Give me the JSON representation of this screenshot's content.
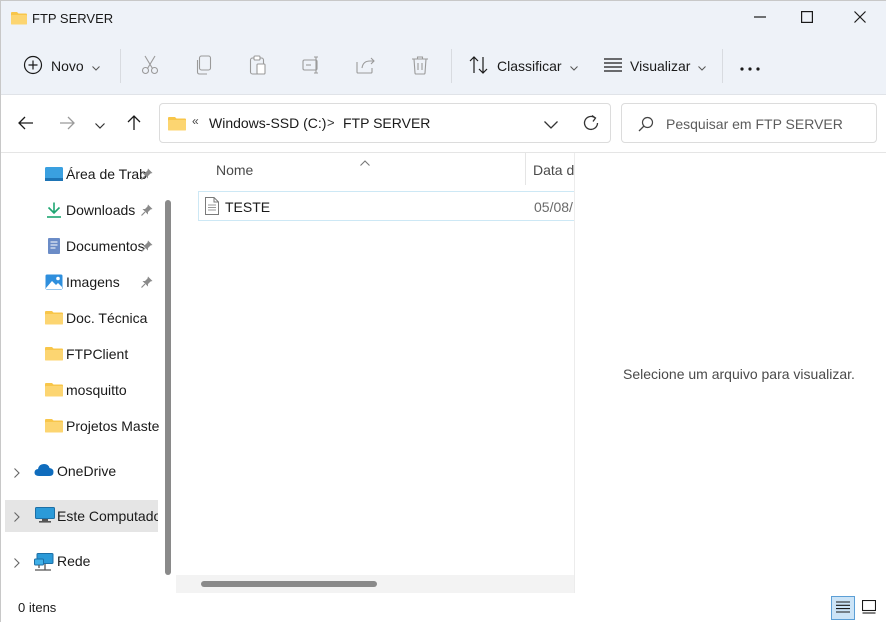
{
  "window": {
    "title": "FTP SERVER"
  },
  "toolbar": {
    "new_label": "Novo",
    "sort_label": "Classificar",
    "view_label": "Visualizar",
    "more_label": "•••"
  },
  "address": {
    "overflow": "«",
    "segments": [
      "Windows-SSD (C:)",
      "FTP SERVER"
    ],
    "separator": ">"
  },
  "search": {
    "placeholder": "Pesquisar em FTP SERVER"
  },
  "sidebar": {
    "quick_access": [
      {
        "label": "Área de Trab",
        "icon": "desktop-icon",
        "pinned": true
      },
      {
        "label": "Downloads",
        "icon": "download-icon",
        "pinned": true
      },
      {
        "label": "Documentos",
        "icon": "document-icon",
        "pinned": true
      },
      {
        "label": "Imagens",
        "icon": "image-icon",
        "pinned": true
      },
      {
        "label": "Doc. Técnica",
        "icon": "folder-icon",
        "pinned": false
      },
      {
        "label": "FTPClient",
        "icon": "folder-icon",
        "pinned": false
      },
      {
        "label": "mosquitto",
        "icon": "folder-icon",
        "pinned": false
      },
      {
        "label": "Projetos Master",
        "icon": "folder-icon",
        "pinned": false
      }
    ],
    "roots": [
      {
        "label": "OneDrive",
        "icon": "cloud-icon"
      },
      {
        "label": "Este Computador",
        "icon": "computer-icon",
        "selected": true
      },
      {
        "label": "Rede",
        "icon": "network-icon"
      }
    ]
  },
  "filelist": {
    "columns": [
      "Nome",
      "Data d"
    ],
    "files": [
      {
        "name": "TESTE",
        "date": "05/08/"
      }
    ]
  },
  "preview": {
    "message": "Selecione um arquivo para visualizar."
  },
  "status": {
    "item_count": "0 itens"
  },
  "colors": {
    "chrome_bg": "#eef2f8",
    "accent": "#0067c0",
    "selection": "#cce4f7",
    "folder": "#f8c64a"
  }
}
